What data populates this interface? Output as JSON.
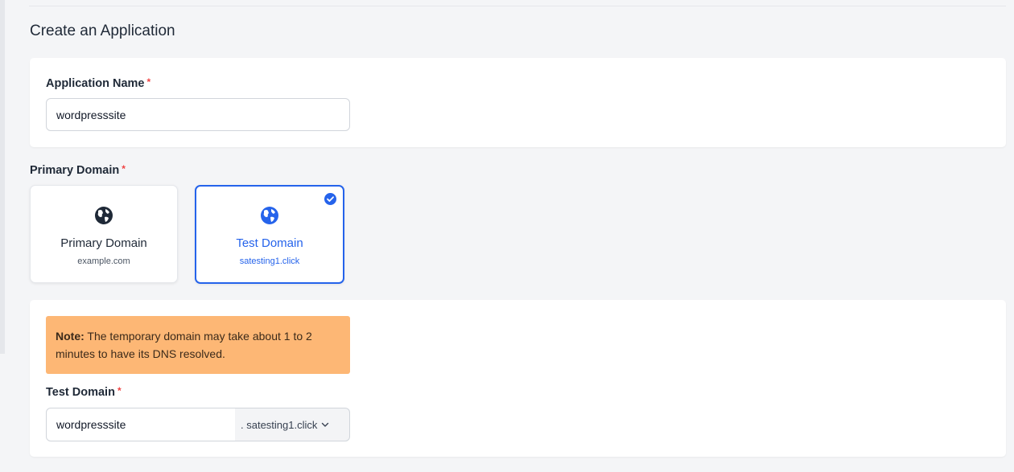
{
  "page": {
    "title": "Create an Application"
  },
  "application_name": {
    "label": "Application Name",
    "required_mark": "*",
    "value": "wordpresssite"
  },
  "primary_domain": {
    "label": "Primary Domain",
    "required_mark": "*",
    "options": [
      {
        "title": "Primary Domain",
        "subtitle": "example.com",
        "icon": "globe-icon",
        "selected": false
      },
      {
        "title": "Test Domain",
        "subtitle": "satesting1.click",
        "icon": "globe-icon",
        "selected": true
      }
    ]
  },
  "test_domain": {
    "note_prefix": "Note:",
    "note_text": " The temporary domain may take about 1 to 2 minutes to have its DNS resolved.",
    "label": "Test Domain",
    "required_mark": "*",
    "value": "wordpresssite",
    "suffix": ". satesting1.click"
  },
  "colors": {
    "accent": "#2563eb",
    "required": "#ef4444",
    "note_bg": "#fdb775",
    "card_bg": "#ffffff",
    "page_bg": "#f4f5f7"
  }
}
